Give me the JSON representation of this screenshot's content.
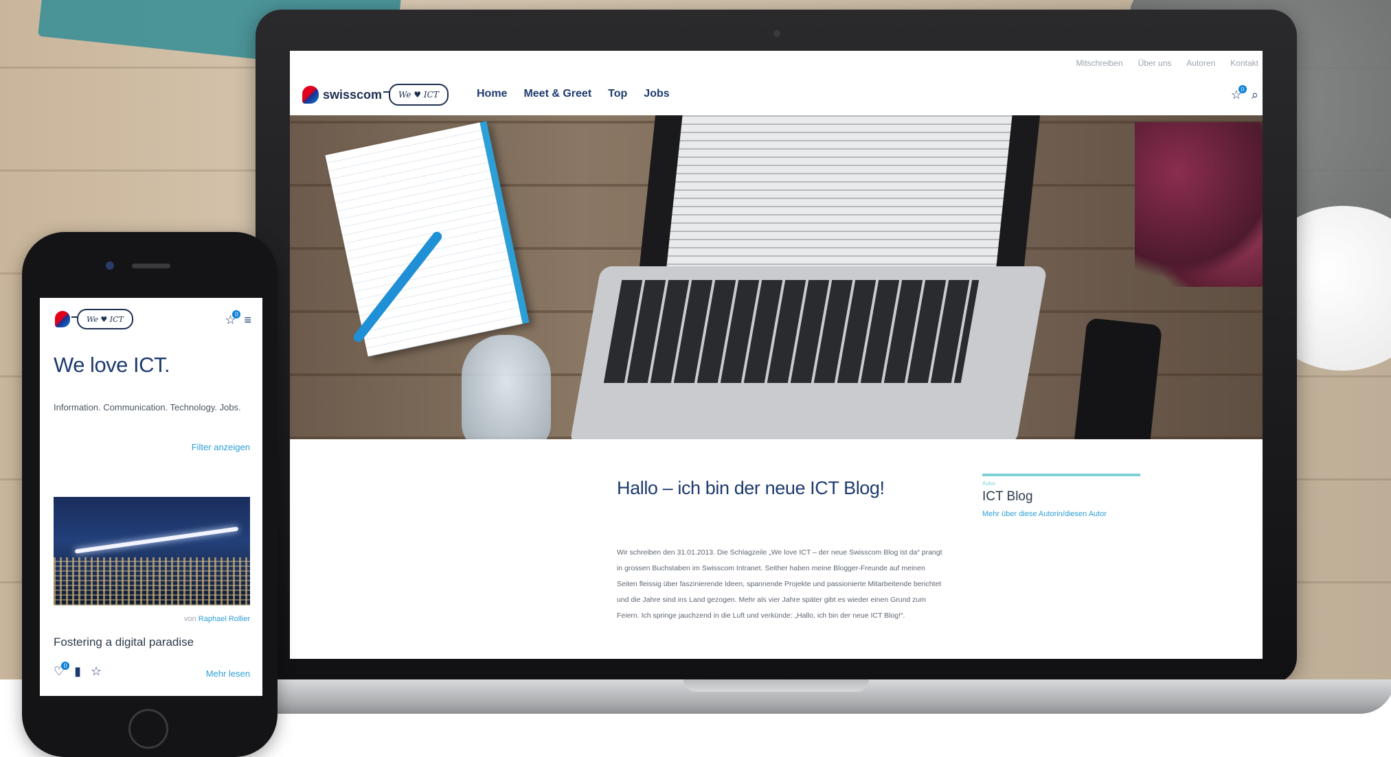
{
  "desktop": {
    "topbar": {
      "items": [
        "Mitschreiben",
        "Über uns",
        "Autoren",
        "Kontakt"
      ]
    },
    "brand": {
      "name": "swisscom",
      "bubble": "We ♥ ICT"
    },
    "nav": {
      "items": [
        "Home",
        "Meet & Greet",
        "Top",
        "Jobs"
      ]
    },
    "icons": {
      "favorites_badge": "0"
    },
    "post": {
      "title": "Hallo – ich bin der neue ICT Blog!",
      "body": "Wir schreiben den 31.01.2013. Die Schlagzeile „We love ICT – der neue Swisscom Blog ist da“ prangt in grossen Buchstaben im Swisscom Intranet. Seither haben meine Blogger-Freunde auf meinen Seiten fleissig über faszinierende Ideen, spannende Projekte und passionierte Mitarbeitende berichtet und die Jahre sind ins Land gezogen. Mehr als vier Jahre später gibt es wieder einen Grund zum Feiern. Ich springe jauchzend in die Luft und verkünde: „Hallo, ich bin der neue ICT Blog!“."
    },
    "sidebar": {
      "tag": "Autor",
      "title": "ICT Blog",
      "link": "Mehr über diese Autorin/diesen Autor"
    }
  },
  "mobile": {
    "brand": {
      "bubble": "We ♥ ICT"
    },
    "icons": {
      "favorites_badge": "0"
    },
    "title": "We love ICT.",
    "subtitle": "Information. Communication. Technology. Jobs.",
    "filter": "Filter anzeigen",
    "author_prefix": "von",
    "author_name": "Raphael Rollier",
    "post_title": "Fostering a digital paradise",
    "likes_badge": "0",
    "more": "Mehr lesen"
  },
  "colors": {
    "brand_navy": "#1d3a6e",
    "link_blue": "#2c9fd6",
    "accent_teal": "#7fd0d3"
  }
}
